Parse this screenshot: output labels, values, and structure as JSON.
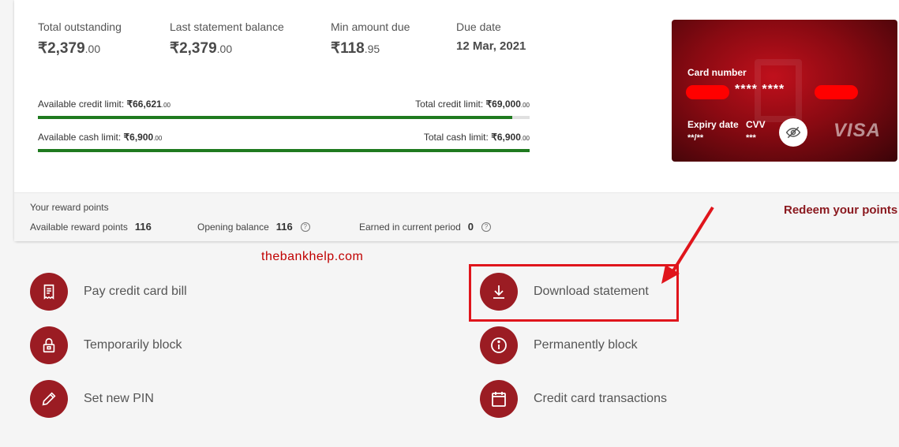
{
  "summary": {
    "total_outstanding": {
      "label": "Total outstanding",
      "main": "₹2,379",
      "dec": ".00"
    },
    "last_statement": {
      "label": "Last statement balance",
      "main": "₹2,379",
      "dec": ".00"
    },
    "min_due": {
      "label": "Min amount due",
      "main": "₹118",
      "dec": ".95"
    },
    "due_date": {
      "label": "Due date",
      "value": "12 Mar, 2021"
    }
  },
  "limits": {
    "credit": {
      "available_label": "Available credit limit:",
      "available_main": "₹66,621",
      "available_dec": ".00",
      "total_label": "Total credit limit:",
      "total_main": "₹69,000",
      "total_dec": ".00",
      "fill_percent": 96.5
    },
    "cash": {
      "available_label": "Available cash limit:",
      "available_main": "₹6,900",
      "available_dec": ".00",
      "total_label": "Total cash limit:",
      "total_main": "₹6,900",
      "total_dec": ".00",
      "fill_percent": 100
    }
  },
  "card": {
    "number_label": "Card number",
    "number_masked": "**** ****",
    "expiry_label": "Expiry date",
    "expiry_value": "**/**",
    "cvv_label": "CVV",
    "cvv_value": "***",
    "brand": "VISA",
    "eye_icon": "eye-off-icon"
  },
  "rewards": {
    "title": "Your reward points",
    "available_label": "Available reward points",
    "available_value": "116",
    "opening_label": "Opening balance",
    "opening_value": "116",
    "earned_label": "Earned in current period",
    "earned_value": "0",
    "help_glyph": "?",
    "redeem_label": "Redeem your points"
  },
  "watermark": "thebankhelp.com",
  "actions": {
    "pay_bill": {
      "label": "Pay credit card bill",
      "icon": "receipt-icon"
    },
    "download_statement": {
      "label": "Download statement",
      "icon": "download-icon"
    },
    "temp_block": {
      "label": "Temporarily block",
      "icon": "lock-icon"
    },
    "perm_block": {
      "label": "Permanently block",
      "icon": "info-icon"
    },
    "set_pin": {
      "label": "Set new PIN",
      "icon": "pencil-icon"
    },
    "transactions": {
      "label": "Credit card transactions",
      "icon": "calendar-icon"
    }
  },
  "colors": {
    "accent": "#9b1c23",
    "progress": "#1f7a1f",
    "annotation": "#e0151c"
  }
}
